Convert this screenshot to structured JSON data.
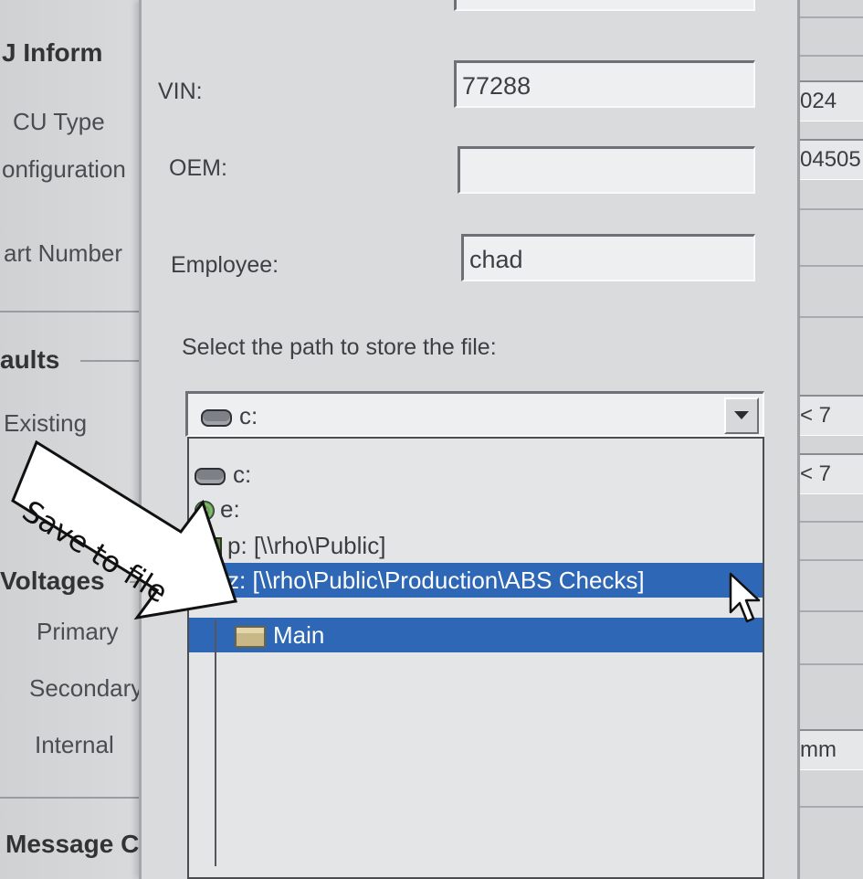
{
  "background_left": {
    "header1": "J Inform",
    "ecu_type": "CU Type",
    "configuration": "onfiguration",
    "part_number": "art Number",
    "header2": "aults",
    "existing": "Existing",
    "header3": "Voltages",
    "primary": "Primary",
    "secondary": "Secondary",
    "internal": "Internal",
    "header4": "Message Cen"
  },
  "background_right": {
    "value1": "024",
    "value2": "04505",
    "value3": "< 7",
    "value4": "< 7",
    "value5": "mm"
  },
  "dialog": {
    "vin_label": "VIN:",
    "vin_value": "77288",
    "oem_label": "OEM:",
    "oem_value": "",
    "employee_label": "Employee:",
    "employee_value": "chad",
    "path_label": "Select the path to store the file:",
    "combo_selected": "c:",
    "dropdown_items": [
      {
        "label": "c:",
        "icon": "drive-icon"
      },
      {
        "label": "e:",
        "icon": "cd-drive-icon"
      },
      {
        "label": "p: [\\\\rho\\Public]",
        "icon": "network-drive-icon"
      },
      {
        "label": "z: [\\\\rho\\Public\\Production\\ABS Checks]",
        "icon": "network-drive-icon"
      },
      {
        "label": "Main",
        "icon": "folder-icon"
      }
    ]
  },
  "annotation": {
    "text": "Save to file"
  },
  "colors": {
    "selection": "#2d67b5",
    "dialog_bg": "#d9dbdc"
  }
}
